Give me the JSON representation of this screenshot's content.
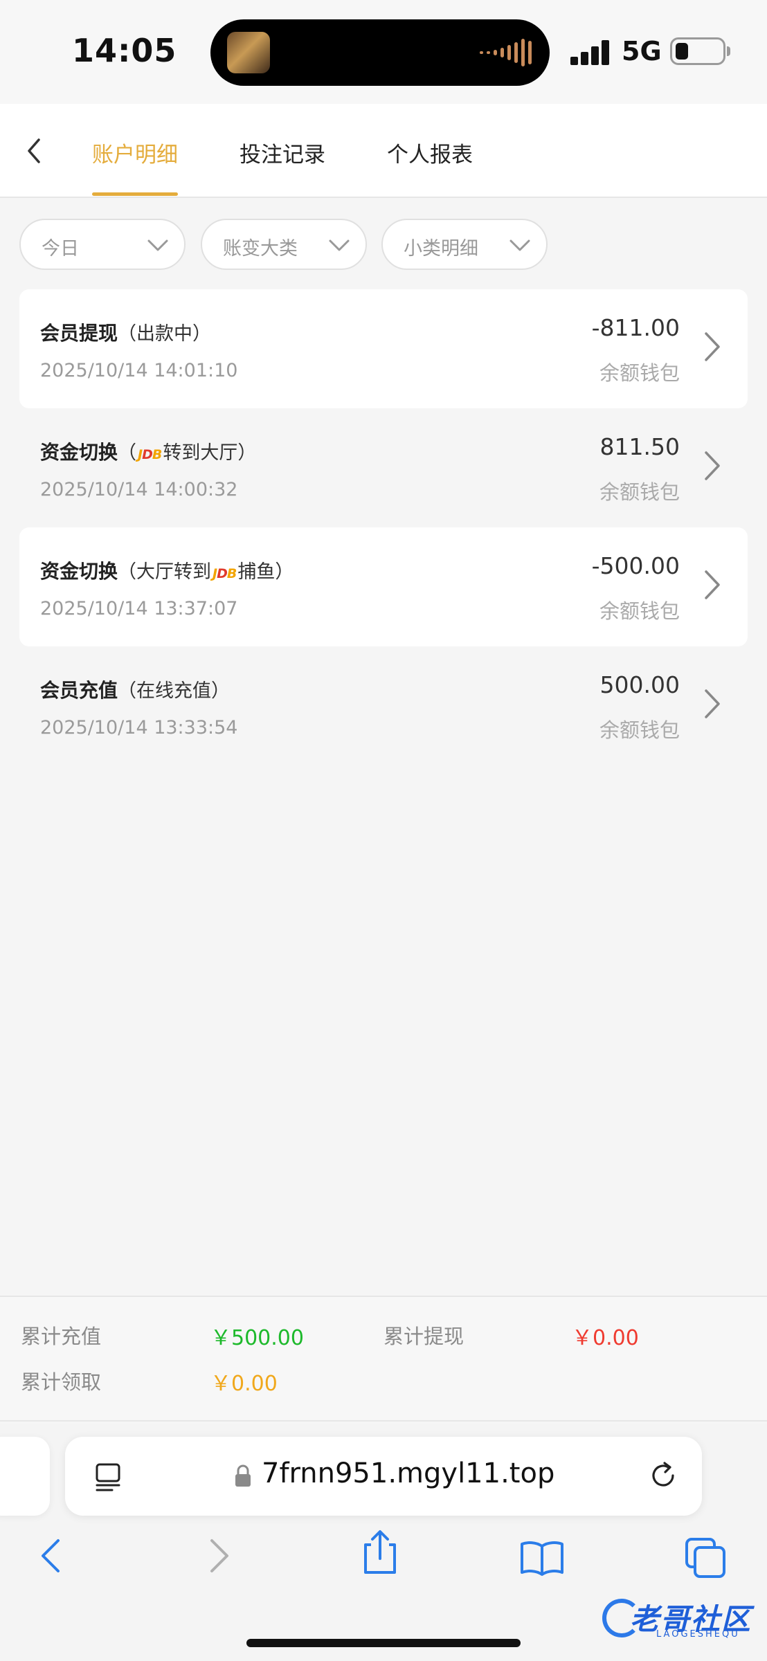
{
  "status_bar": {
    "time": "14:05",
    "network": "5G"
  },
  "nav": {
    "tabs": [
      {
        "label": "账户明细",
        "active": true
      },
      {
        "label": "投注记录",
        "active": false
      },
      {
        "label": "个人报表",
        "active": false
      }
    ]
  },
  "filters": [
    {
      "label": "今日"
    },
    {
      "label": "账变大类"
    },
    {
      "label": "小类明细"
    }
  ],
  "records": [
    {
      "type": "会员提现",
      "paren_pre": "（出款中）",
      "logo": "",
      "paren_post": "",
      "date": "2025/10/14 14:01:10",
      "amount": "-811.00",
      "wallet": "余额钱包"
    },
    {
      "type": "资金切换",
      "paren_pre": "（",
      "logo": "JDB",
      "paren_post": "转到大厅）",
      "date": "2025/10/14 14:00:32",
      "amount": "811.50",
      "wallet": "余额钱包"
    },
    {
      "type": "资金切换",
      "paren_pre": "（大厅转到",
      "logo": "JDB",
      "paren_post": "捕鱼）",
      "date": "2025/10/14 13:37:07",
      "amount": "-500.00",
      "wallet": "余额钱包"
    },
    {
      "type": "会员充值",
      "paren_pre": "（在线充值）",
      "logo": "",
      "paren_post": "",
      "date": "2025/10/14 13:33:54",
      "amount": "500.00",
      "wallet": "余额钱包"
    }
  ],
  "summary": {
    "total_recharge_label": "累计充值",
    "total_recharge_value": "￥500.00",
    "total_withdraw_label": "累计提现",
    "total_withdraw_value": "￥0.00",
    "total_claim_label": "累计领取",
    "total_claim_value": "￥0.00",
    "colors": {
      "recharge": "#1db92b",
      "withdraw": "#ef3b30",
      "claim": "#f0a81c"
    }
  },
  "browser": {
    "url": "7frnn951.mgyl11.top"
  },
  "watermark": {
    "text": "老哥社区",
    "sub": "LAOGESHEQU"
  },
  "accent_color": "#e4ac3c"
}
